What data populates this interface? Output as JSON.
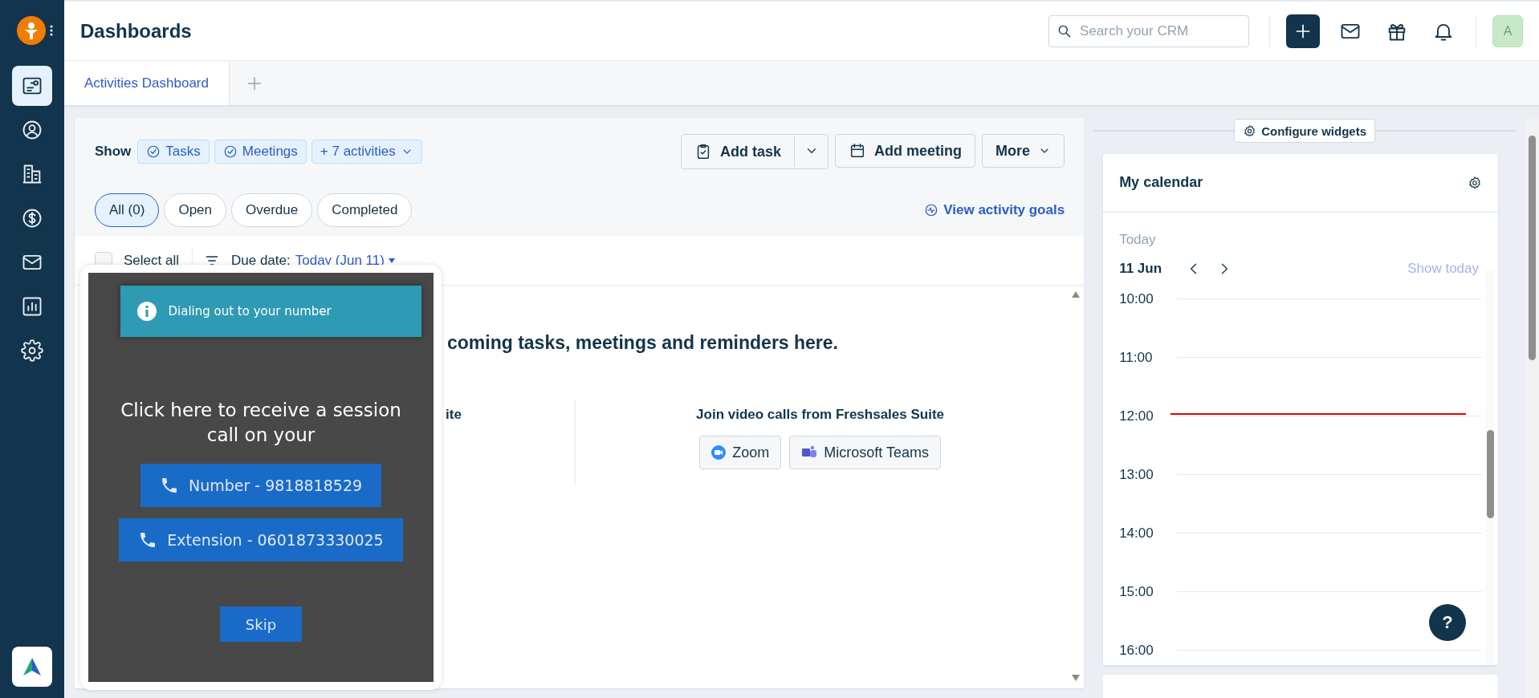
{
  "sidebar": {
    "items": [
      {
        "kind": "dashboard",
        "selected": true
      },
      {
        "kind": "contacts",
        "selected": false
      },
      {
        "kind": "accounts",
        "selected": false
      },
      {
        "kind": "deals",
        "selected": false
      },
      {
        "kind": "mail",
        "selected": false
      },
      {
        "kind": "reports",
        "selected": false
      },
      {
        "kind": "settings",
        "selected": false
      }
    ]
  },
  "header": {
    "title": "Dashboards",
    "search": {
      "placeholder": "Search your CRM"
    },
    "avatar": "A"
  },
  "tabs": [
    {
      "label": "Activities Dashboard",
      "selected": true
    }
  ],
  "toolbar": {
    "show_label": "Show",
    "filters": [
      {
        "label": "Tasks",
        "kind": "check"
      },
      {
        "label": "Meetings",
        "kind": "check"
      },
      {
        "label": "+ 7 activities",
        "kind": "dropdown"
      }
    ],
    "actions": [
      {
        "label": "Add task",
        "kind": "split"
      },
      {
        "label": "Add meeting",
        "kind": "calendar"
      },
      {
        "label": "More",
        "kind": "dropdown"
      }
    ]
  },
  "status_tabs": [
    {
      "label": "All (0)",
      "selected": true
    },
    {
      "label": "Open",
      "selected": false
    },
    {
      "label": "Overdue",
      "selected": false
    },
    {
      "label": "Completed",
      "selected": false
    }
  ],
  "goals_link": "View activity goals",
  "list_header": {
    "select_all": {
      "label": "Select all",
      "checked": false
    },
    "sort_label": "Due date:",
    "sort_value": "Today (Jun 11)"
  },
  "empty_state": {
    "message": "coming tasks, meetings and reminders here.",
    "left_heading": "ite",
    "right_heading": "Join video calls from Freshsales Suite",
    "video_apps": [
      {
        "label": "Zoom",
        "kind": "zoom"
      },
      {
        "label": "Microsoft Teams",
        "kind": "teams"
      }
    ]
  },
  "call_popup": {
    "banner": "Dialing out to your number",
    "prompt": "Click here to receive a session call on your",
    "options": [
      "Number - 9818818529",
      "Extension - 0601873330025"
    ],
    "skip": "Skip"
  },
  "widgets": {
    "configure": "Configure widgets",
    "calendar": {
      "title": "My calendar",
      "day_label": "Today",
      "date": "11 Jun",
      "show_today": "Show today",
      "hours": [
        {
          "label": "10:00",
          "now": false
        },
        {
          "label": "11:00",
          "now": false
        },
        {
          "label": "12:00",
          "now": true
        },
        {
          "label": "13:00",
          "now": false
        },
        {
          "label": "14:00",
          "now": false
        },
        {
          "label": "15:00",
          "now": false
        },
        {
          "label": "16:00",
          "now": false
        }
      ]
    }
  },
  "help": "?"
}
